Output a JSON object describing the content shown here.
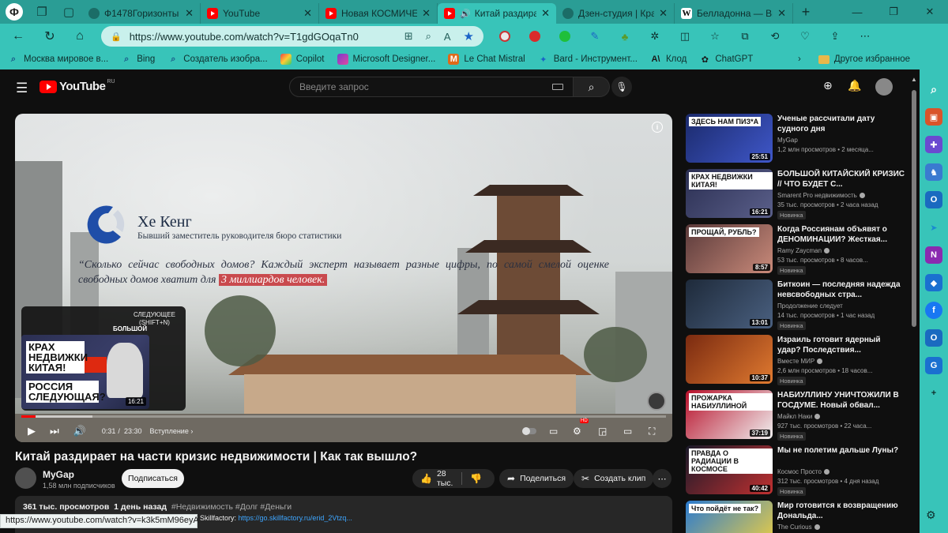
{
  "browser": {
    "tabs": [
      {
        "label": "Ф1478Горизонты"
      },
      {
        "label": "YouTube"
      },
      {
        "label": "Новая КОСМИЧЕСТ"
      },
      {
        "label": "Китай раздира"
      },
      {
        "label": "Дзен-студия | Кра"
      },
      {
        "label": "Белладонна — Ви"
      }
    ],
    "url": "https://www.youtube.com/watch?v=T1gdGOqaTn0",
    "bookmarks": [
      "Москва мировое в...",
      "Bing",
      "Создатель изобра...",
      "Copilot",
      "Microsoft Designer...",
      "Le Chat Mistral",
      "Bard - Инструмент...",
      "Клод",
      "ChatGPT"
    ],
    "other_favorites": "Другое избранное",
    "status_url": "https://www.youtube.com/watch?v=k3k5mM96eyA"
  },
  "youtube": {
    "logo_text": "YouTube",
    "logo_region": "RU",
    "search_placeholder": "Введите запрос"
  },
  "player": {
    "speaker_name": "Хе Кенг",
    "speaker_role": "Бывший заместитель руководителя бюро статистики",
    "quote_main": "“Сколько сейчас свободных домов? Каждый эксперт называет разные цифры, по самой смелой оценке свободных домов хватит для ",
    "quote_highlight": "3 миллиардов человек.",
    "upnext_label": "СЛЕДУЮЩЕЕ (SHIFT+N)",
    "upnext_title": "БОЛЬШОЙ",
    "upnext_caption_top": "КРАХ НЕДВИЖКИ КИТАЯ!",
    "upnext_caption_bottom": "РОССИЯ СЛЕДУЮЩАЯ?",
    "upnext_duration": "16:21",
    "time_current": "0:31",
    "time_separator": "/",
    "time_total": "23:30",
    "chapter": "Вступление",
    "progress_fraction": 0.022,
    "buffered_fraction": 0.11,
    "hd_badge": "HD"
  },
  "video": {
    "title": "Китай раздирает на части кризис недвижимости | Как так вышло?",
    "channel": "MyGap",
    "subscribers": "1,58 млн подписчиков",
    "subscribe_label": "Подписаться",
    "likes": "28 тыс.",
    "share_label": "Поделиться",
    "clip_label": "Создать клип",
    "views": "361 тыс. просмотров",
    "age": "1 день назад",
    "tags": "#Недвижимость #Долг #Деньги",
    "desc_prefix": "Skillfactory:",
    "desc_link": "https://go.skillfactory.ru/erid_2Vtzq..."
  },
  "recommendations": [
    {
      "title": "Ученые рассчитали дату судного дня",
      "channel": "MyGap",
      "meta": "1,2 млн просмотров • 2 месяца...",
      "duration": "25:51",
      "badge": "",
      "caption": "ЗДЕСЬ НАМ ПИЗ*А",
      "verified": false,
      "thumb": [
        "#1b2a6b",
        "#3f57c9"
      ]
    },
    {
      "title": "БОЛЬШОЙ КИТАЙСКИЙ КРИЗИС // ЧТО БУДЕТ С...",
      "channel": "Smarent Pro недвижимость",
      "meta": "35 тыс. просмотров • 2 часа назад",
      "duration": "16:21",
      "badge": "Новинка",
      "caption": "КРАХ НЕДВИЖКИ КИТАЯ!",
      "verified": true,
      "thumb": [
        "#2b2f52",
        "#5a5f8a"
      ]
    },
    {
      "title": "Когда Россиянам объявят о ДЕНОМИНАЦИИ? Жесткая...",
      "channel": "Ramy Zayсman",
      "meta": "53 тыс. просмотров • 8 часов...",
      "duration": "8:57",
      "badge": "Новинка",
      "caption": "ПРОЩАЙ, РУБЛЬ?",
      "verified": true,
      "thumb": [
        "#5a3a3a",
        "#c98a7a"
      ]
    },
    {
      "title": "Биткоин — последняя надежда невсвободных стра...",
      "channel": "Продолжение следует",
      "meta": "14 тыс. просмотров • 1 час назад",
      "duration": "13:01",
      "badge": "Новинка",
      "caption": "",
      "verified": false,
      "thumb": [
        "#1e2a3a",
        "#4a6080"
      ]
    },
    {
      "title": "Израиль готовит ядерный удар? Последствия...",
      "channel": "Вместе МИР",
      "meta": "2,6 млн просмотров • 18 часов...",
      "duration": "10:37",
      "badge": "Новинка",
      "caption": "",
      "verified": true,
      "thumb": [
        "#7a2a10",
        "#e07a30"
      ]
    },
    {
      "title": "НАБИУЛЛИНУ УНИЧТОЖИЛИ В ГОСДУМЕ. Новый обвал...",
      "channel": "Майкл Наки",
      "meta": "927 тыс. просмотров • 22 часа...",
      "duration": "37:19",
      "badge": "Новинка",
      "caption": "ПРОЖАРКА НАБИУЛЛИНОЙ",
      "verified": true,
      "thumb": [
        "#b8102a",
        "#f0f0f0"
      ]
    },
    {
      "title": "Мы не полетим дальше Луны?",
      "channel": "Космос Просто",
      "meta": "312 тыс. просмотров • 4 дня назад",
      "duration": "40:42",
      "badge": "Новинка",
      "caption": "ПРАВДА О РАДИАЦИИ В КОСМОСЕ",
      "verified": true,
      "thumb": [
        "#1a1a2a",
        "#c03030"
      ]
    },
    {
      "title": "Мир готовится к возвращению Дональда...",
      "channel": "The Curious",
      "meta": "",
      "duration": "",
      "badge": "",
      "caption": "Что пойдёт не так?",
      "verified": true,
      "thumb": [
        "#2a7ad0",
        "#f0d040"
      ]
    }
  ],
  "colors": {
    "chrome": "#38c4b9",
    "tabstrip": "#2a9d95",
    "yt_red": "#ff0000",
    "quote_highlight": "#c94a4e",
    "link": "#3ea6ff"
  }
}
